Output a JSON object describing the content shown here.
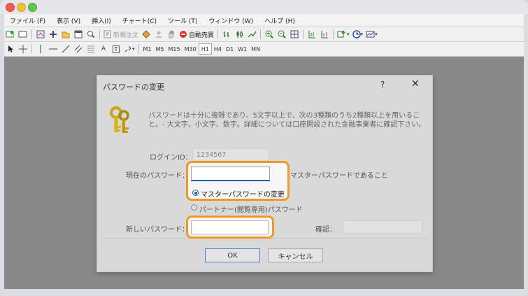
{
  "menubar": {
    "items": [
      "ファイル (F)",
      "表示 (V)",
      "挿入(I)",
      "チャート(C)",
      "ツール (T)",
      "ウィンドウ (W)",
      "ヘルプ (H)"
    ]
  },
  "toolbar": {
    "new_order_label": "新規注文",
    "auto_trade_label": "自動売買",
    "timeframes": [
      "M1",
      "M5",
      "M15",
      "M30",
      "H1",
      "H4",
      "D1",
      "W1",
      "MN"
    ],
    "text_tool": "A",
    "text_label_tool": "T"
  },
  "dialog": {
    "title": "パスワードの変更",
    "help": "?",
    "close": "✕",
    "description": "パスワードは十分に複雑であり、5文字以上で、次の3種類のうち2種類以上を用いること。- 大文字、小文字、数字。詳細については口座開設された金融事業者に確認下さい。",
    "login_label": "ログインID：",
    "login_value": "1234567",
    "current_password_label": "現在のパスワード：",
    "current_password_value": "",
    "master_note": "マスターパスワードであること",
    "radio_master": "マスターパスワードの変更",
    "radio_partner": "パートナー(閲覧専用)パスワード",
    "new_password_label": "新しいパスワード：",
    "new_password_value": "",
    "confirm_label": "確認：",
    "confirm_value": "",
    "ok_label": "OK",
    "cancel_label": "キャンセル"
  },
  "colors": {
    "highlight": "#ef9a28",
    "radio_selected": "#1b55b0"
  },
  "icons": {
    "dialog": "keys-icon"
  }
}
